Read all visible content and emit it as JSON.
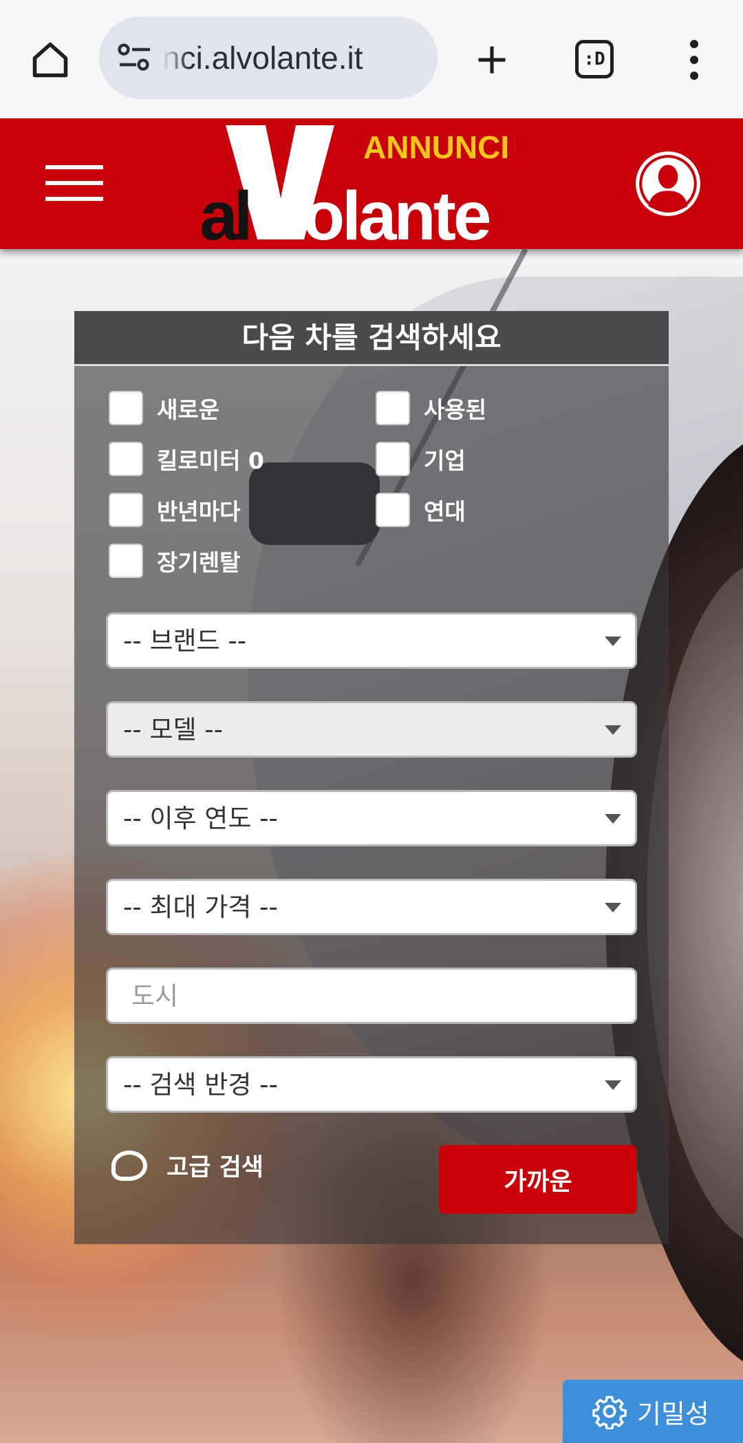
{
  "browser": {
    "url": "nci.alvolante.it",
    "tab_count": ":D"
  },
  "header": {
    "logo_top": "ANNUNCI",
    "logo_main": "alVolante"
  },
  "search": {
    "title": "다음 차를 검색하세요",
    "checkboxes": [
      "새로운",
      "사용된",
      "킬로미터 0",
      "기업",
      "반년마다",
      "연대",
      "장기렌탈"
    ],
    "brand": "-- 브랜드 --",
    "model": "-- 모델 --",
    "year_from": "-- 이후 연도 --",
    "max_price": "-- 최대 가격 --",
    "city_placeholder": "도시",
    "radius": "-- 검색 반경 --",
    "advanced": "고급 검색",
    "submit": "가까운"
  },
  "privacy": {
    "label": "기밀성"
  },
  "colors": {
    "brand_red": "#c8000a",
    "logo_yellow": "#f5c518",
    "privacy_blue": "#3c8fd8"
  }
}
